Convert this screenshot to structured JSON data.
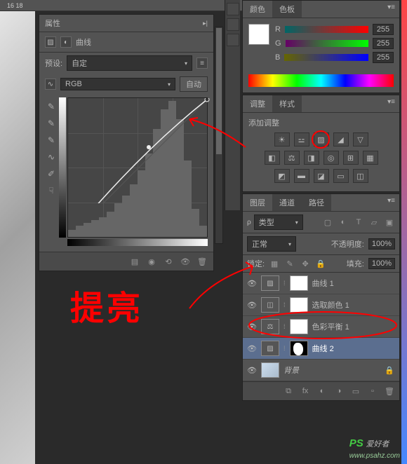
{
  "ruler": {
    "marks": "16                           18"
  },
  "properties": {
    "tab": "属性",
    "title": "曲线",
    "preset_label": "预设:",
    "preset_value": "自定",
    "channel_value": "RGB",
    "auto_btn": "自动"
  },
  "color": {
    "tab1": "颜色",
    "tab2": "色板",
    "r": "R",
    "g": "G",
    "b": "B",
    "rv": "255",
    "gv": "255",
    "bv": "255"
  },
  "adjust": {
    "tab1": "调整",
    "tab2": "样式",
    "title": "添加调整"
  },
  "layers": {
    "tab1": "图层",
    "tab2": "通道",
    "tab3": "路径",
    "kind_label": "类型",
    "blend": "正常",
    "opacity_label": "不透明度:",
    "opacity_val": "100%",
    "lock_label": "锁定:",
    "fill_label": "填充:",
    "fill_val": "100%",
    "items": [
      {
        "name": "曲线 1"
      },
      {
        "name": "选取颜色 1"
      },
      {
        "name": "色彩平衡 1"
      },
      {
        "name": "曲线 2"
      },
      {
        "name": "背景"
      }
    ]
  },
  "handwriting": "提亮",
  "watermark": {
    "logo": "PS",
    "text": "爱好者",
    "url": "www.psahz.com"
  }
}
